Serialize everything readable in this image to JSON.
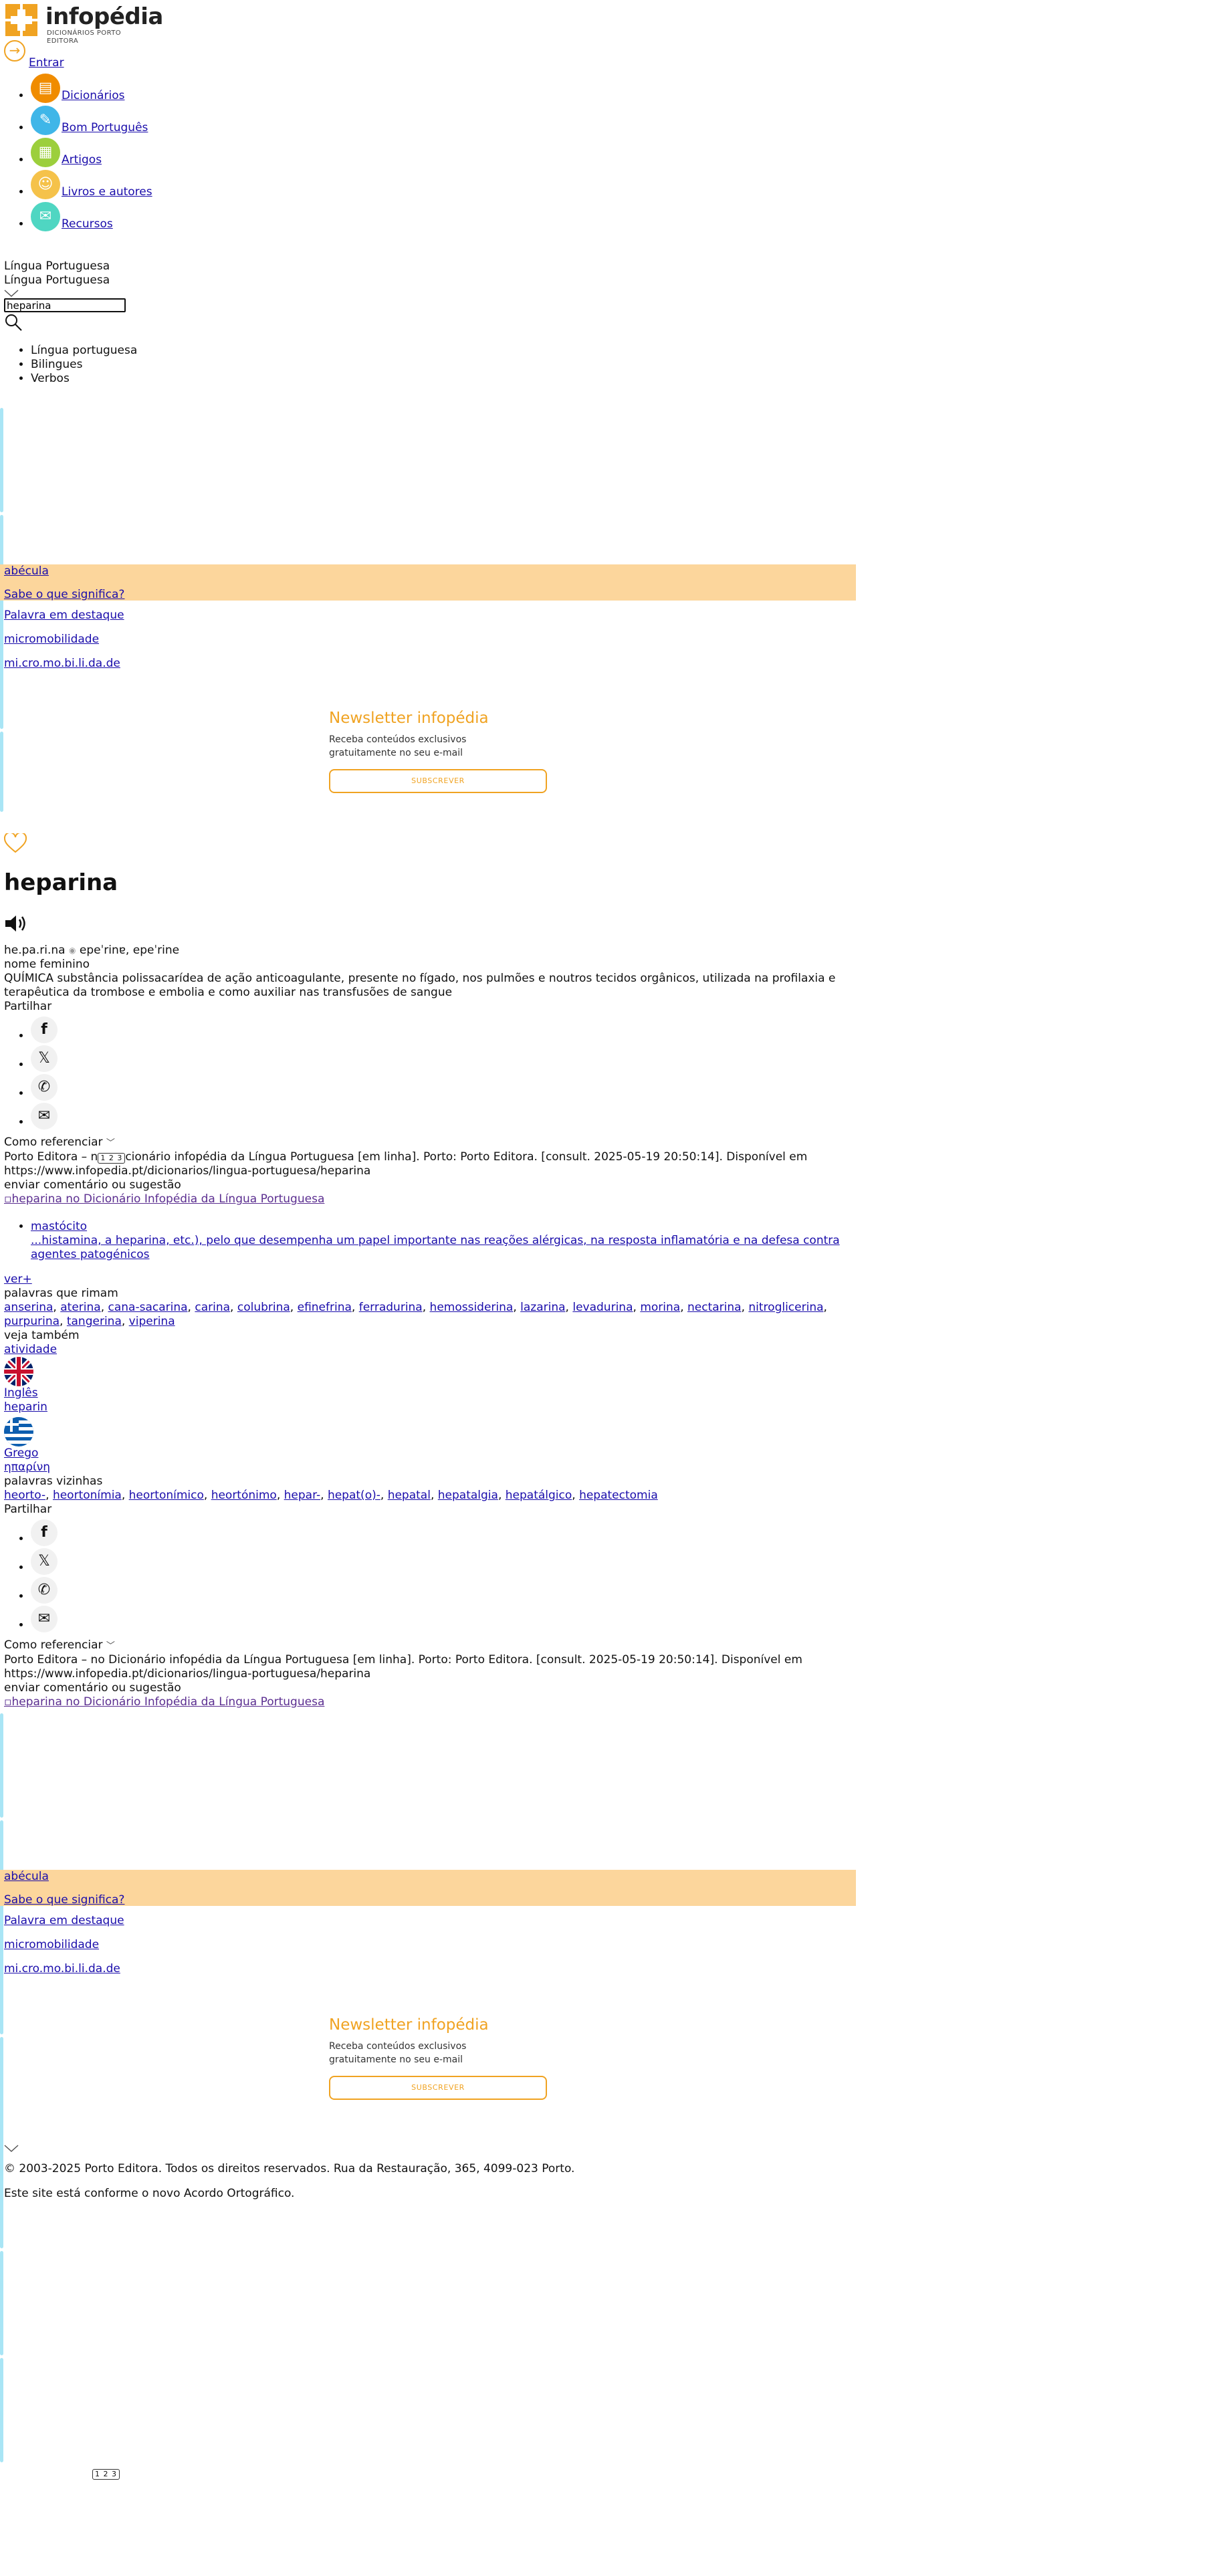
{
  "brand": {
    "name": "infopédia",
    "subtitle": "DICIONÁRIOS PORTO EDITORA",
    "color": "#f0a322"
  },
  "header": {
    "login_label": "Entrar",
    "login_icon": "login-icon"
  },
  "nav": {
    "items": [
      {
        "label": "Dicionários",
        "icon": "book-icon",
        "color": "#f08c00"
      },
      {
        "label": "Bom Português",
        "icon": "pen-icon",
        "color": "#3fb6e8"
      },
      {
        "label": "Artigos",
        "icon": "document-icon",
        "color": "#9ccf3c"
      },
      {
        "label": "Livros e autores",
        "icon": "author-icon",
        "color": "#f5c24a"
      },
      {
        "label": "Recursos",
        "icon": "resources-icon",
        "color": "#4fd6c2"
      }
    ]
  },
  "language": {
    "label": "Língua Portuguesa",
    "selected": "Língua Portuguesa"
  },
  "search": {
    "value": "heparina"
  },
  "dict_nav": {
    "items": [
      "Língua portuguesa",
      "Bilingues",
      "Verbos"
    ]
  },
  "widget": {
    "abecula": "abécula",
    "know_meaning": "Sabe o que significa?",
    "featured_label": "Palavra em destaque",
    "featured_word": "micromobilidade",
    "featured_syllables": "mi.cro.mo.bi.li.da.de"
  },
  "newsletter": {
    "title": "Newsletter infopédia",
    "text_line1": "Receba conteúdos exclusivos",
    "text_line2": "gratuitamente no seu e-mail",
    "button": "SUBSCREVER"
  },
  "entry": {
    "headword": "heparina",
    "syllables": "he.pa.ri.na",
    "pronunciation": "epeˈrinɐ, epeˈrine",
    "grammar": "nome feminino",
    "definition": "QUÍMICA substância polissacarídea de ação anticoagulante, presente no fígado, nos pulmões e noutros tecidos orgânicos, utilizada na profilaxia e terapêutica da trombose e embolia e como auxiliar nas transfusões de sangue"
  },
  "share": {
    "label": "Partilhar",
    "networks": [
      "facebook-icon",
      "x-icon",
      "whatsapp-icon",
      "email-icon"
    ]
  },
  "reference": {
    "title": "Como referenciar",
    "citation_pre": "Porto Editora – n",
    "citation_post": "cionário infopédia da Língua Portuguesa [em linha]. Porto: Porto Editora. [consult. 2025-05-19 20:50:14]. Disponível em https://www.infopedia.pt/dicionarios/lingua-portuguesa/heparina",
    "citation_full": "Porto Editora – no Dicionário infopédia da Língua Portuguesa [em linha]. Porto: Porto Editora. [consult. 2025-05-19 20:50:14]. Disponível em https://www.infopedia.pt/dicionarios/lingua-portuguesa/heparina",
    "feedback": "enviar comentário ou sugestão",
    "image_alt": "heparina no Dicionário Infopédia da Língua Portuguesa"
  },
  "related": {
    "word": "mastócito",
    "snippet": "...histamina, a heparina, etc.), pelo que desempenha um papel importante nas reações alérgicas, na resposta inflamatória e na defesa contra agentes patogénicos",
    "more": "ver+"
  },
  "rhymes": {
    "title": "palavras que rimam",
    "words": [
      "anserina",
      "aterina",
      "cana-sacarina",
      "carina",
      "colubrina",
      "efinefrina",
      "ferradurina",
      "hemossiderina",
      "lazarina",
      "levadurina",
      "morina",
      "nectarina",
      "nitroglicerina",
      "purpurina",
      "tangerina",
      "viperina"
    ]
  },
  "see_also": {
    "title": "veja também",
    "word": "atividade"
  },
  "translations": [
    {
      "language": "Inglês",
      "word": "heparin",
      "flag": "uk-flag-icon"
    },
    {
      "language": "Grego",
      "word": "ηπαρίνη",
      "flag": "greece-flag-icon"
    }
  ],
  "neighbors": {
    "title": "palavras vizinhas",
    "words": [
      "heorto-,",
      "heortonímia,",
      "heortonímico,",
      "heortónimo,",
      "hepar-,",
      "hepat(o)-,",
      "hepatal,",
      "hepatalgia,",
      "hepatálgico,",
      "hepatectomia"
    ]
  },
  "footer": {
    "copyright": "© 2003-2025 Porto Editora. Todos os direitos reservados. Rua da Restauração, 365, 4099-023 Porto.",
    "ao": "Este site está conforme o novo Acordo Ortográfico."
  },
  "pill": {
    "text": "1 2 3"
  }
}
